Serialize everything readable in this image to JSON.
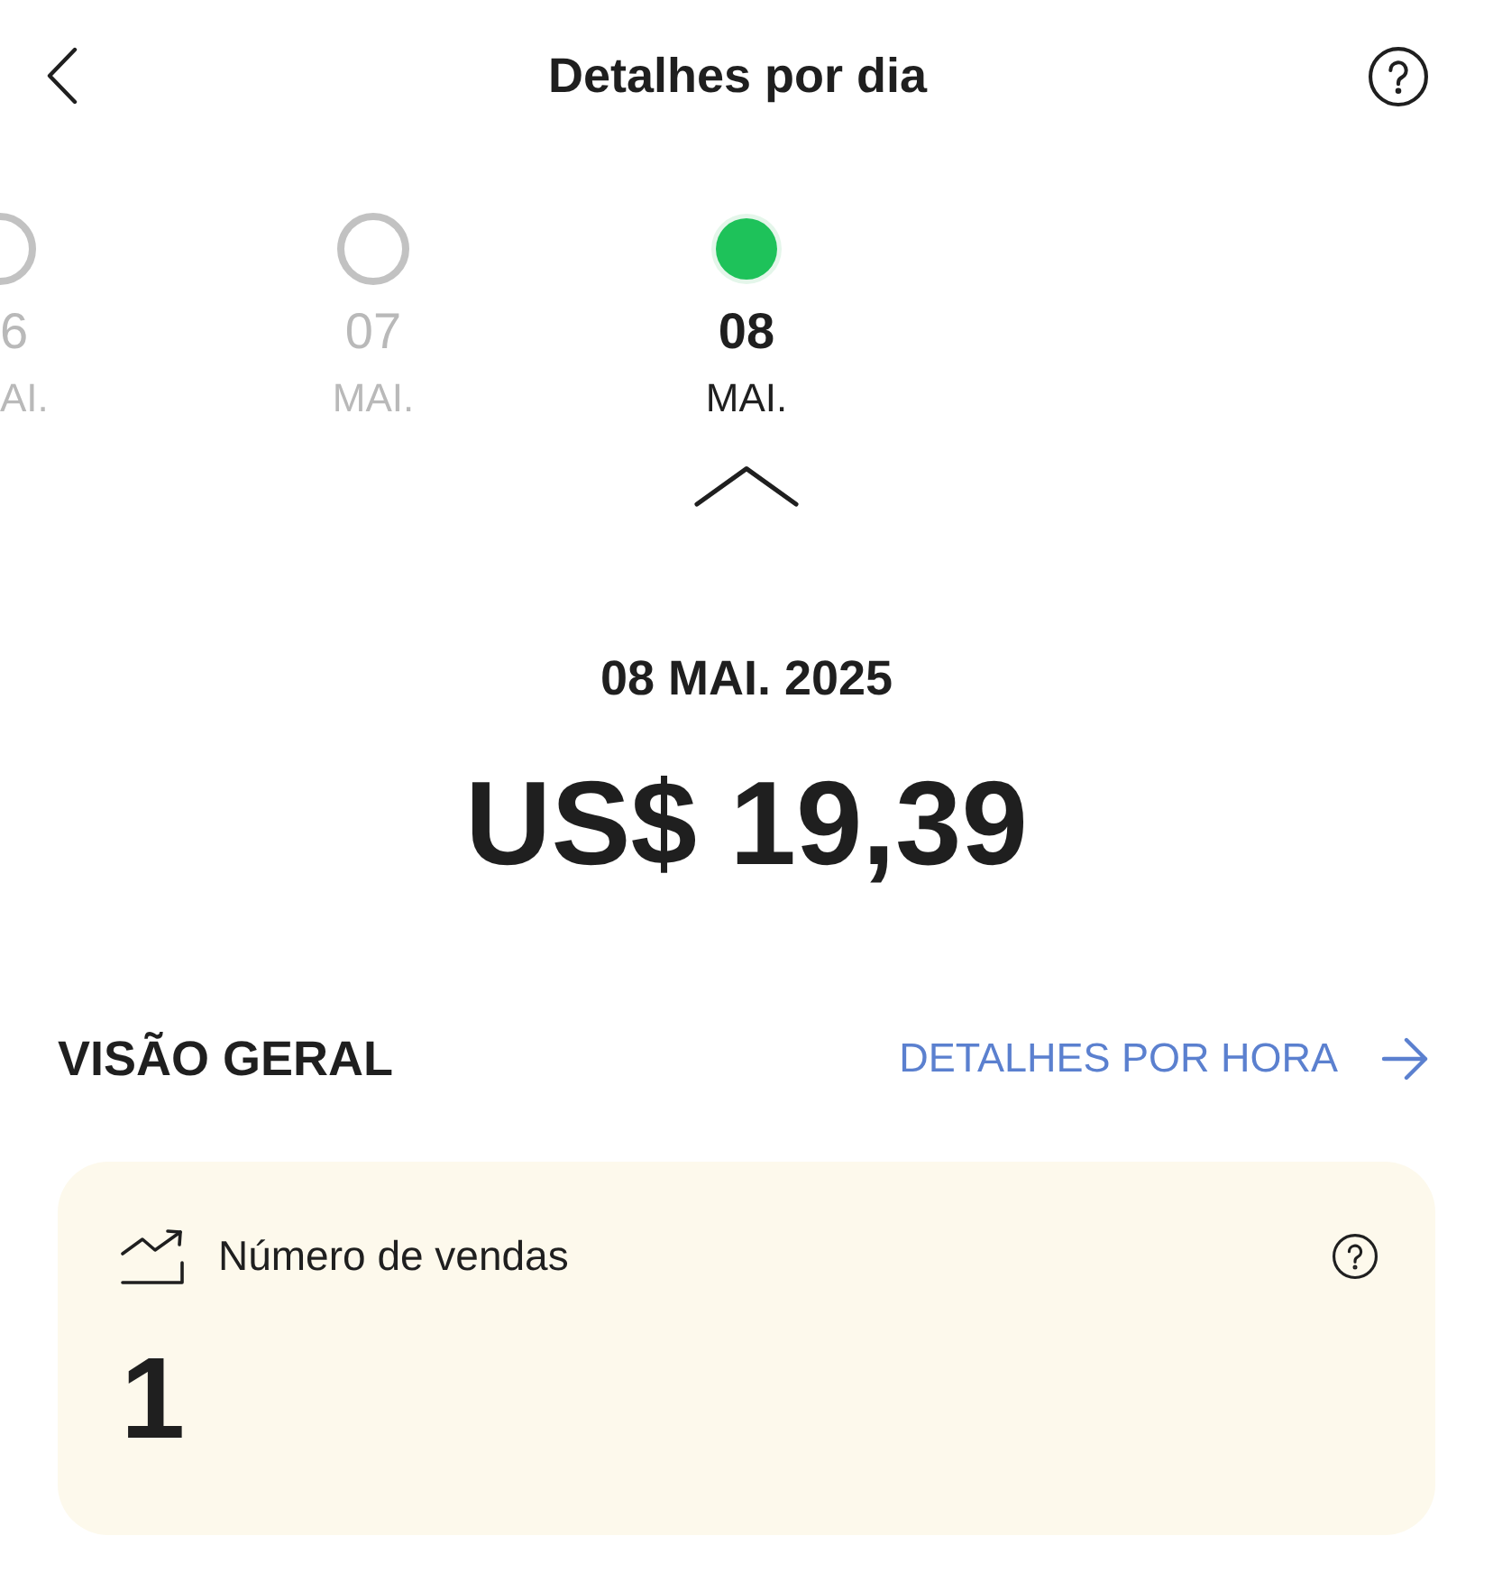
{
  "header": {
    "title": "Detalhes por dia"
  },
  "days": [
    {
      "kind": "clipped",
      "day": "6",
      "month": "AI.",
      "selected": false
    },
    {
      "kind": "full",
      "day": "07",
      "month": "MAI.",
      "selected": false
    },
    {
      "kind": "full",
      "day": "08",
      "month": "MAI.",
      "selected": true
    }
  ],
  "summary": {
    "date": "08 MAI. 2025",
    "amount": "US$ 19,39"
  },
  "overview": {
    "title": "VISÃO GERAL",
    "link": "DETALHES POR HORA"
  },
  "metrics": [
    {
      "label": "Número de vendas",
      "value": "1"
    }
  ]
}
